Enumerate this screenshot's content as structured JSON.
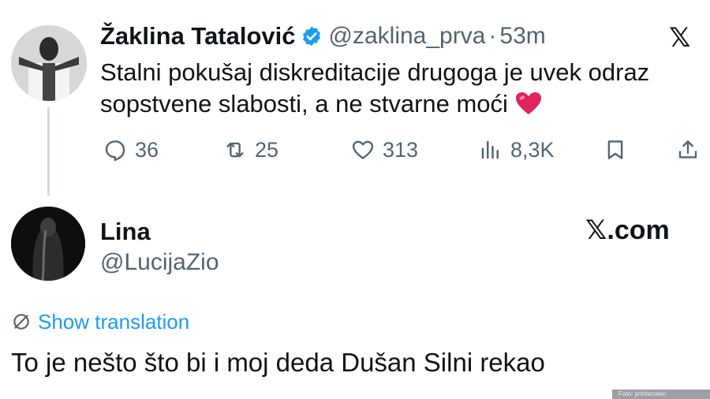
{
  "tweet": {
    "author_name": "Žaklina Tatalović",
    "handle": "@zaklina_prva",
    "separator": "·",
    "time": "53m",
    "text": "Stalni pokušaj diskreditacije drugoga je uvek odraz sopstvene slabosti, a ne stvarne moći",
    "emoji": "❤️",
    "logo": "𝕏",
    "stats": {
      "replies": "36",
      "retweets": "25",
      "likes": "313",
      "views": "8,3K"
    }
  },
  "reply": {
    "author_name": "Lina",
    "handle": "@LucijaZio",
    "site_label": "𝕏.com",
    "translation_label": "Show translation",
    "text": "To je nešto što bi i moj deda Dušan Silni rekao"
  },
  "colors": {
    "verified": "#1d9bf0",
    "link": "#1d9bf0",
    "like_heart": "#e0245e",
    "secondary_text": "#536471"
  },
  "icons": [
    "verified-badge-icon",
    "x-logo-icon",
    "reply-icon",
    "retweet-icon",
    "like-icon",
    "views-icon",
    "bookmark-icon",
    "share-icon",
    "translate-icon"
  ],
  "watermark": "Foto: printscreen"
}
